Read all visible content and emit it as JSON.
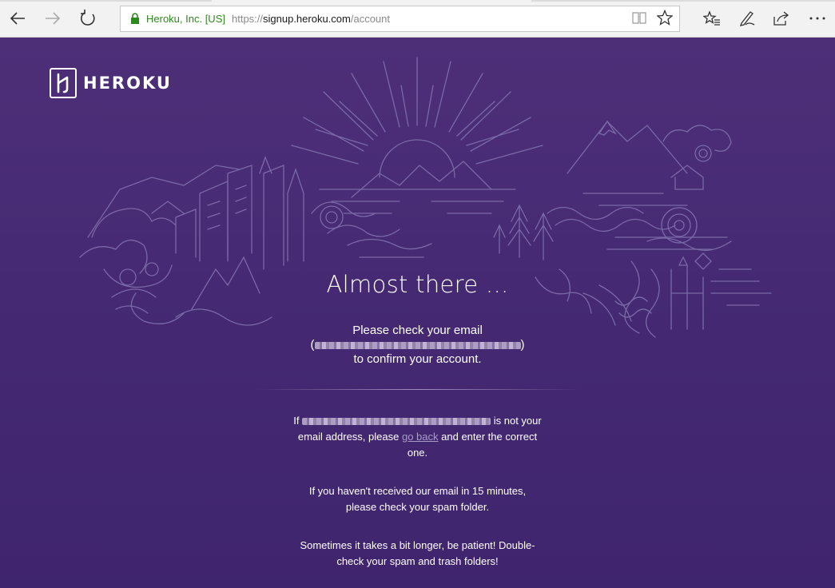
{
  "browser": {
    "org_label": "Heroku, Inc. [US]",
    "url_scheme": "https://",
    "url_host": "signup.heroku.com",
    "url_path": "/account",
    "icons": [
      "back-icon",
      "forward-icon",
      "refresh-icon",
      "lock-icon",
      "reading-view-icon",
      "favorite-star-icon",
      "favorites-hub-icon",
      "web-note-icon",
      "share-icon",
      "more-icon"
    ]
  },
  "brand": {
    "name": "HEROKU"
  },
  "main": {
    "headline": "Almost there ...",
    "check_line1": "Please check your email",
    "email_open": "(",
    "email_close": ")",
    "check_line3": "to confirm your account.",
    "p1_if": "If",
    "p1_not_your": "is not your",
    "p1_middle": "email address, please",
    "p1_link": "go back",
    "p1_end": "and enter the correct",
    "p1_last": "one.",
    "p2_line1": "If you haven't received our email in 15 minutes,",
    "p2_line2": "please check your spam folder.",
    "p3_line1": "Sometimes it takes a bit longer, be patient! Double-",
    "p3_line2": "check your spam and trash folders!"
  },
  "colors": {
    "background_top": "#4d2f78",
    "background_bottom": "#3f246e",
    "illustration_stroke": "#7a68a8",
    "link": "#a99cc5",
    "secure_green": "#2b8a1b"
  }
}
